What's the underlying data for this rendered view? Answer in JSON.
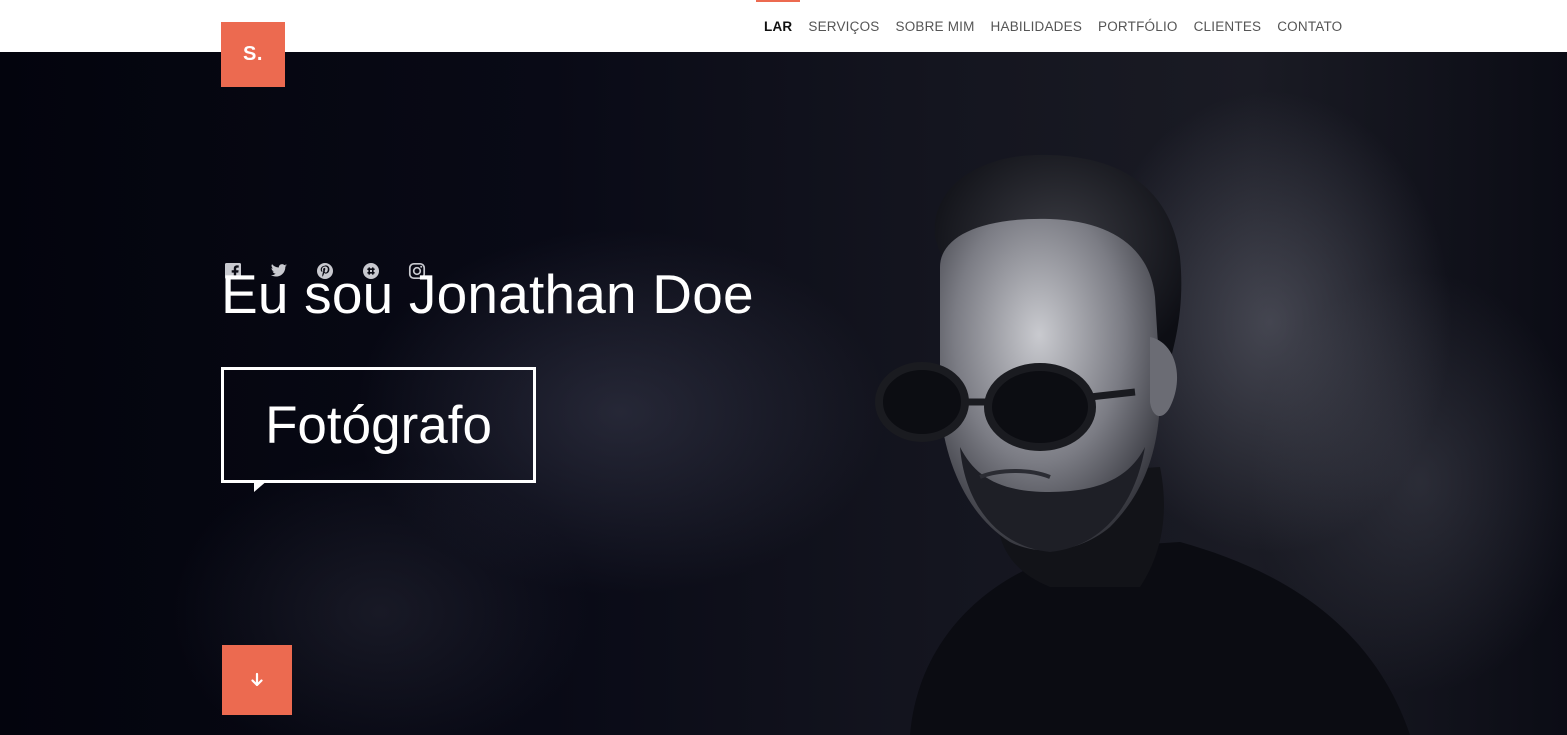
{
  "logo": {
    "text": "S."
  },
  "nav": {
    "items": [
      {
        "label": "LAR",
        "active": true
      },
      {
        "label": "SERVIÇOS",
        "active": false
      },
      {
        "label": "SOBRE MIM",
        "active": false
      },
      {
        "label": "HABILIDADES",
        "active": false
      },
      {
        "label": "PORTFÓLIO",
        "active": false
      },
      {
        "label": "CLIENTES",
        "active": false
      },
      {
        "label": "CONTATO",
        "active": false
      }
    ]
  },
  "hero": {
    "socials": [
      "facebook-icon",
      "twitter-icon",
      "pinterest-icon",
      "slack-icon",
      "instagram-icon"
    ],
    "headline": "Eu sou Jonathan Doe",
    "role": "Fotógrafo",
    "scroll_icon": "arrow-down-icon"
  },
  "colors": {
    "accent": "#ec6a50",
    "hero_bg": "#04050f",
    "nav_bg": "#ffffff",
    "text_light": "#ffffff"
  }
}
